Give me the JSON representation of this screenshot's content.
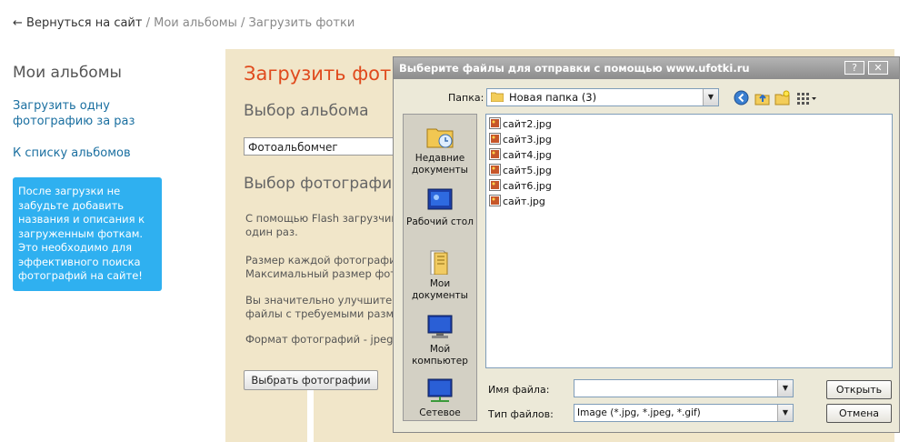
{
  "breadcrumb": {
    "back": "← Вернуться на сайт",
    "sep1": " / ",
    "albums": "Мои альбомы",
    "sep2": " / ",
    "current": "Загрузить фотки"
  },
  "sidebar": {
    "title": "Мои альбомы",
    "links": [
      "Загрузить одну фотографию за раз",
      "К списку альбомов"
    ],
    "tip": "После загрузки не забудьте добавить названия и описания к загруженным фоткам. Это необходимо для эффективного поиска фотографий на сайте!"
  },
  "main": {
    "title": "Загрузить фотки",
    "album_heading": "Выбор альбома",
    "album_value": "Фотоальбомчег",
    "photos_heading": "Выбор фотографий",
    "p1_l1": "С помощью Flash загрузчика",
    "p1_l2": "один раз.",
    "p2_l1": "Размер каждой фотографии",
    "p2_l2": "Максимальный размер фото",
    "p3_l1": "Вы значительно улучшите ка",
    "p3_l2": "файлы с требуемыми разме",
    "p4": "Формат фотографий - jpeg. (р",
    "choose_button": "Выбрать фотографии"
  },
  "dialog": {
    "title": "Выберите файлы для отправки с помощью www.ufotki.ru",
    "help_btn": "?",
    "close_btn": "✕",
    "folder_label": "Папка:",
    "folder_value": "Новая папка (3)",
    "places": [
      {
        "label": "Недавние документы",
        "icon": "recent-documents-icon"
      },
      {
        "label": "Рабочий стол",
        "icon": "desktop-icon"
      },
      {
        "label": "Мои документы",
        "icon": "my-documents-icon"
      },
      {
        "label": "Мой компьютер",
        "icon": "my-computer-icon"
      },
      {
        "label": "Сетевое",
        "icon": "network-icon"
      }
    ],
    "files": [
      "сайт2.jpg",
      "сайт3.jpg",
      "сайт4.jpg",
      "сайт5.jpg",
      "сайт6.jpg",
      "сайт.jpg"
    ],
    "filename_label": "Имя файла:",
    "filename_value": "",
    "filetype_label": "Тип файлов:",
    "filetype_value": "Image (*.jpg, *.jpeg, *.gif)",
    "open_button": "Открыть",
    "cancel_button": "Отмена"
  },
  "colors": {
    "accent_title": "#e04a1d",
    "link": "#1a6fa0",
    "tip_bg": "#2fb0f0",
    "main_bg": "#f1e6c9"
  }
}
